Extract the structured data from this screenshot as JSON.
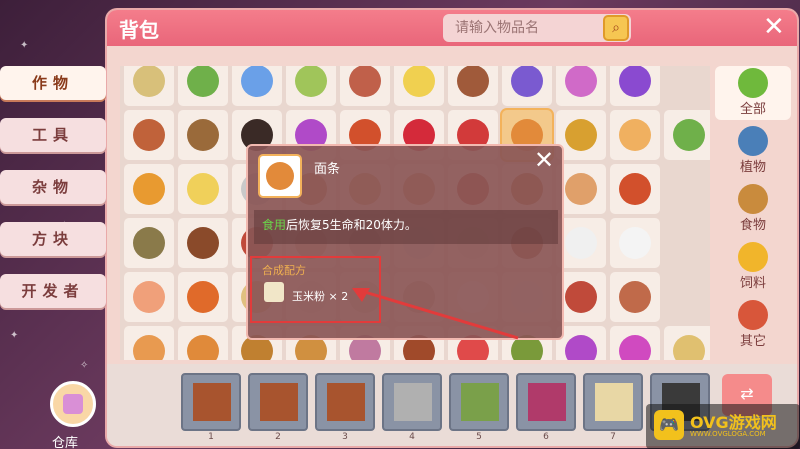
{
  "window": {
    "title": "背包",
    "close_glyph": "✕"
  },
  "search": {
    "placeholder": "请输入物品名",
    "button_icon": "magnifier-icon"
  },
  "sidebar": {
    "items": [
      {
        "label": "作物",
        "active": true
      },
      {
        "label": "工具",
        "active": false
      },
      {
        "label": "杂物",
        "active": false
      },
      {
        "label": "方块",
        "active": false
      },
      {
        "label": "开发者",
        "active": false
      }
    ]
  },
  "categories": {
    "items": [
      {
        "label": "全部",
        "icon": "cucumber-icon",
        "color": "#6fb93c",
        "active": true
      },
      {
        "label": "植物",
        "icon": "plant-icon",
        "color": "#4a7fb8",
        "active": false
      },
      {
        "label": "食物",
        "icon": "basket-icon",
        "color": "#c98b3d",
        "active": false
      },
      {
        "label": "饲料",
        "icon": "feed-icon",
        "color": "#f1b52b",
        "active": false
      },
      {
        "label": "其它",
        "icon": "misc-icon",
        "color": "#d8563a",
        "active": false
      }
    ]
  },
  "grid": {
    "colors": [
      [
        "#d8c07a",
        "#6fb04a",
        "#6aa0e8",
        "#a0c55a",
        "#c0604a",
        "#f0d050",
        "#a05a3a",
        "#7a5ad0",
        "#d06ac8",
        "#8a4ad0"
      ],
      [
        "#c0623a",
        "#9a6a3a",
        "#3a2a26",
        "#b04ac8",
        "#d2502c",
        "#d42a3a",
        "#d23a3a",
        "#e28a3a",
        "#d8a030",
        "#f0b060",
        "#6fb04a"
      ],
      [
        "#e89a30",
        "#f0d05a",
        "#c9c9c9",
        "#c48a5a",
        "#d9a06a",
        "#d99a6a",
        "#c04a3a",
        "#c0703a",
        "#e0a06a",
        "#d2502c"
      ],
      [
        "#8a7a4a",
        "#8a4a2a",
        "#c04a3a",
        "#e0c0a0",
        "#d0c0b0",
        "#e0e0e0",
        "#f0e0d0",
        "#a05a3a",
        "#f0f0f0",
        "#f4f4f4"
      ],
      [
        "#f0a07a",
        "#e06a2a",
        "#e0c080",
        "#f0e0d0",
        "#e0d0c0",
        "#d8c0a0",
        "#ffffff",
        "#f0f0f0",
        "#c04a3a",
        "#c06a4a"
      ],
      [
        "#e89a50",
        "#e08a3a",
        "#c08030",
        "#d09040",
        "#c07aa0",
        "#a04a2a",
        "#e04a4a",
        "#7a9a3a",
        "#b04ac8",
        "#d04ac0",
        "#e0c070"
      ]
    ]
  },
  "tooltip": {
    "thumb_icon": "noodle-bowl-icon",
    "name": "面条",
    "desc_keyword": "食用",
    "desc_rest": "后恢复5生命和20体力。",
    "recipe_title": "合成配方",
    "recipe_icon": "corn-flour-icon",
    "recipe_text": "玉米粉 × 2",
    "close_glyph": "✕"
  },
  "hotbar": {
    "slots": [
      {
        "num": "1",
        "icon": "dirt-block-icon",
        "color": "#a8542e"
      },
      {
        "num": "2",
        "icon": "dirt-block-icon",
        "color": "#a8542e"
      },
      {
        "num": "3",
        "icon": "dirt-block-icon",
        "color": "#a8542e"
      },
      {
        "num": "4",
        "icon": "stone-block-icon",
        "color": "#b0b0b0"
      },
      {
        "num": "5",
        "icon": "bamboo-icon",
        "color": "#7aa04a"
      },
      {
        "num": "6",
        "icon": "magenta-block-icon",
        "color": "#b03a6a"
      },
      {
        "num": "7",
        "icon": "tent-icon",
        "color": "#e8d7a5"
      },
      {
        "num": "8",
        "icon": "dark-block-icon",
        "color": "#3a3a3a"
      }
    ],
    "swap_icon": "swap-arrows-icon",
    "swap_glyph": "⇄"
  },
  "bag_button": {
    "label": "仓库",
    "icon": "warehouse-icon"
  },
  "watermark": {
    "title": "OVG游戏网",
    "subtitle": "WWW.OVGLOGA.COM",
    "icon": "gamepad-icon",
    "glyph": "🎮"
  }
}
